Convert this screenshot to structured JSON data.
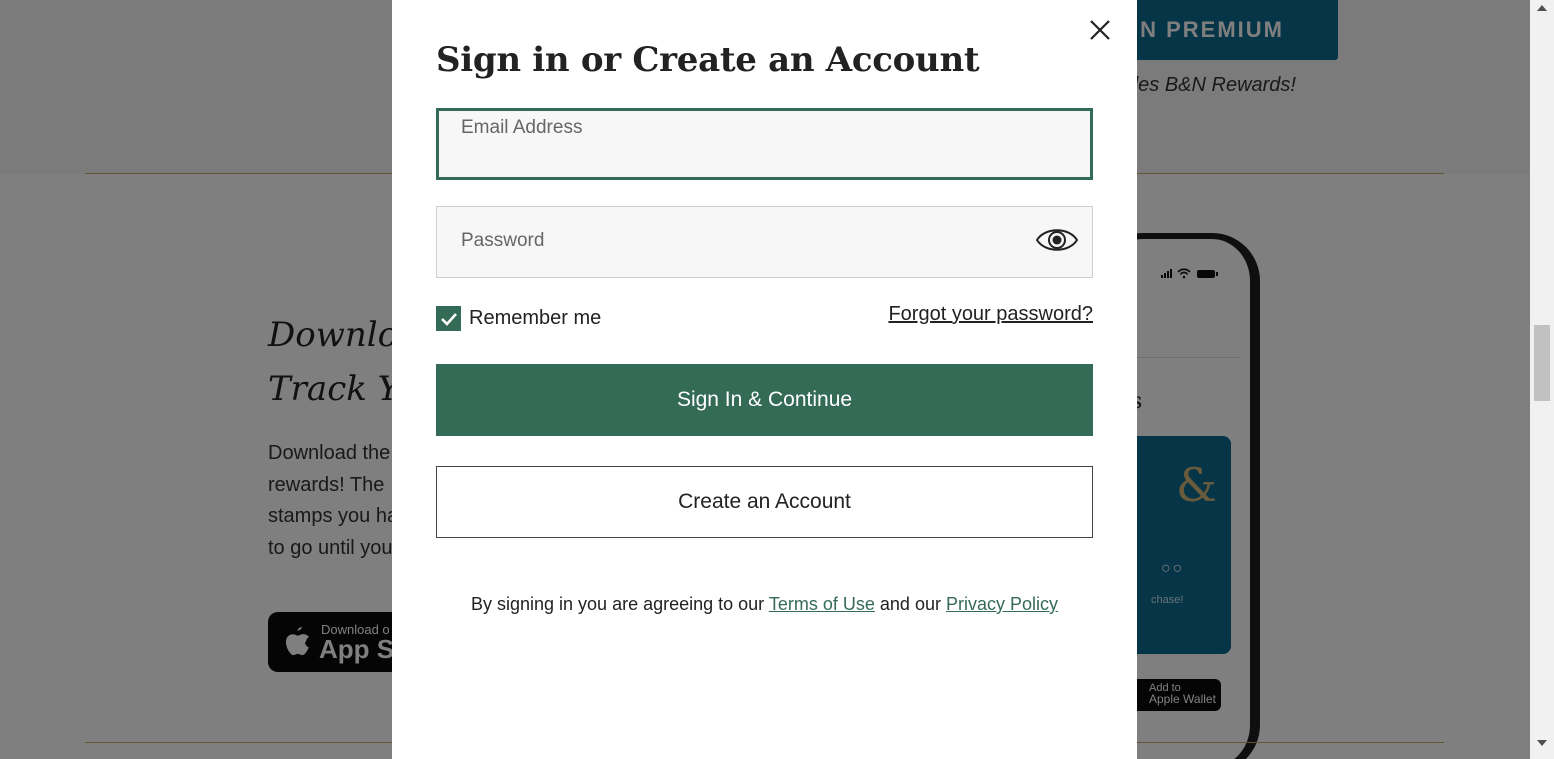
{
  "background": {
    "premium_button_label": "IN PREMIUM",
    "premium_note": "des B&N Rewards!",
    "download_heading_line1": "Downlo",
    "download_heading_line2": "Track Y",
    "download_body_lines": [
      "Download the",
      "rewards! The",
      "stamps you ha",
      "to go until you"
    ],
    "app_badge_small": "Download o",
    "app_badge_big": "App St",
    "phone_amp": "&",
    "phone_dots": "○○",
    "phone_card_note": "chase!",
    "phone_wallet_small": "Add to",
    "phone_wallet_big": "Apple Wallet",
    "phone_s": "s"
  },
  "modal": {
    "title": "Sign in or Create an Account",
    "email": {
      "label": "Email Address",
      "value": ""
    },
    "password": {
      "label": "Password",
      "value": ""
    },
    "remember_label": "Remember me",
    "remember_checked": true,
    "forgot_link": "Forgot your password?",
    "sign_in_button": "Sign In & Continue",
    "create_account_button": "Create an Account",
    "legal": {
      "prefix": "By signing in you are agreeing to our",
      "terms": "Terms of Use",
      "middle": "and our",
      "privacy": "Privacy Policy"
    }
  },
  "colors": {
    "accent_green": "#346b57",
    "premium_blue": "#0a6a8e",
    "gold_rule": "#c7a86a"
  },
  "icons": [
    "close-icon",
    "eye-icon",
    "checkmark-icon",
    "apple-icon",
    "scroll-up-icon",
    "scroll-down-icon"
  ]
}
